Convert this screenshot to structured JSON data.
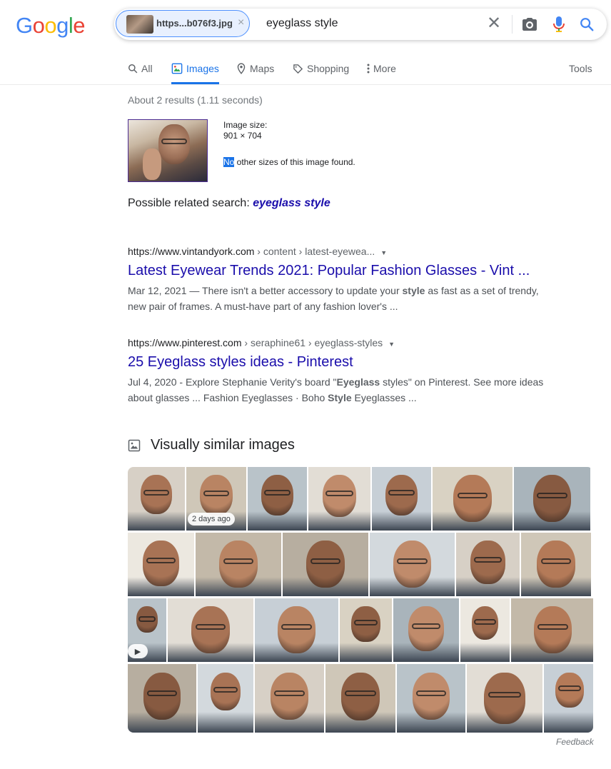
{
  "logo": {
    "letters": [
      "G",
      "o",
      "o",
      "g",
      "l",
      "e"
    ]
  },
  "search": {
    "chip_label": "https...b076f3.jpg",
    "chip_close": "×",
    "query": "eyeglass style",
    "clear": "✕"
  },
  "tabs": [
    {
      "label": "All",
      "icon": "search-icon"
    },
    {
      "label": "Images",
      "icon": "image-icon"
    },
    {
      "label": "Maps",
      "icon": "map-pin-icon"
    },
    {
      "label": "Shopping",
      "icon": "tag-icon"
    },
    {
      "label": "More",
      "icon": "more-vert-icon"
    }
  ],
  "tools_label": "Tools",
  "stats": "About 2 results (1.11 seconds)",
  "query_image": {
    "size_label": "Image size:",
    "size_value": "901 × 704",
    "no_sizes_hl": "No",
    "no_sizes_rest": " other sizes of this image found."
  },
  "related": {
    "prefix": "Possible related search: ",
    "term": "eyeglass style"
  },
  "results": [
    {
      "cite_domain": "https://www.vintandyork.com",
      "cite_path": " › content › latest-eyewea...",
      "title": "Latest Eyewear Trends 2021: Popular Fashion Glasses - Vint ...",
      "snippet_parts": [
        "Mar 12, 2021 — There isn't a better accessory to update your ",
        "style",
        " as fast as a set of trendy, new pair of frames. A must-have part of any fashion lover's ..."
      ]
    },
    {
      "cite_domain": "https://www.pinterest.com",
      "cite_path": " › seraphine61 › eyeglass-styles",
      "title": "25 Eyeglass styles ideas - Pinterest",
      "snippet_parts": [
        "Jul 4, 2020 - Explore Stephanie Verity's board \"",
        "Eyeglass",
        " styles\" on Pinterest. See more ideas about glasses ... Fashion Eyeglasses · Boho ",
        "Style",
        " Eyeglasses ..."
      ]
    }
  ],
  "visually_similar": {
    "heading": "Visually similar images",
    "badge": "2 days ago",
    "play": "▶"
  },
  "feedback": "Feedback",
  "colors": {
    "link": "#1a0dab",
    "accent": "#1a73e8"
  }
}
